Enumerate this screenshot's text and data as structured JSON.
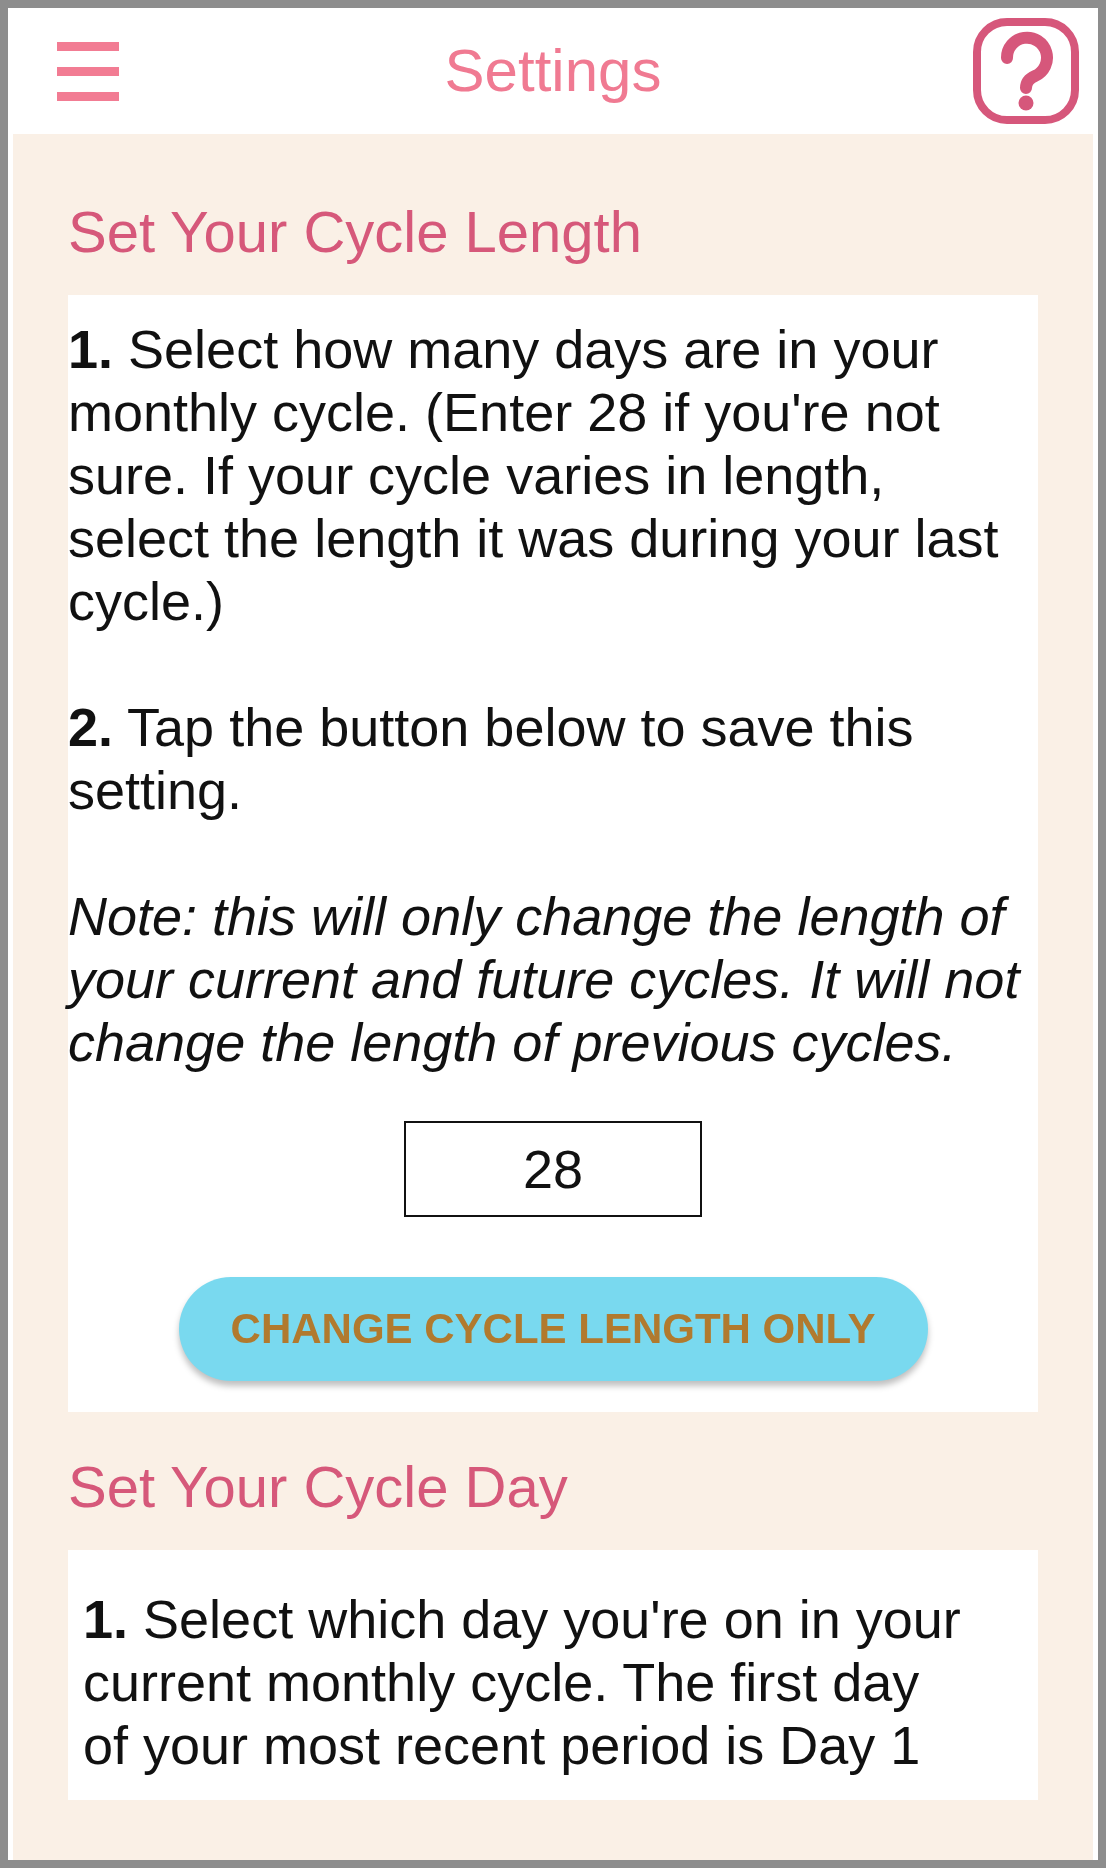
{
  "header": {
    "title": "Settings"
  },
  "sections": [
    {
      "heading": "Set Your Cycle Length",
      "paragraphs": [
        {
          "kind": "step",
          "text": "**1.** Select how many days are in your monthly cycle. (Enter 28 if you're not sure. If your cycle varies in length, select the length it was during your last cycle.)"
        },
        {
          "kind": "step",
          "text": "**2.** Tap the button below to save this setting."
        },
        {
          "kind": "note",
          "text": "Note: this will only change the length of your current and future cycles. It will not change the length of previous cycles."
        }
      ],
      "input": {
        "value": "28"
      },
      "button": {
        "label": "CHANGE CYCLE LENGTH ONLY"
      }
    },
    {
      "heading": "Set Your Cycle Day",
      "paragraphs": [
        {
          "kind": "step",
          "text": "**1.** Select which day you're on in your current monthly cycle. The first day of your most recent period is Day 1"
        }
      ]
    }
  ]
}
